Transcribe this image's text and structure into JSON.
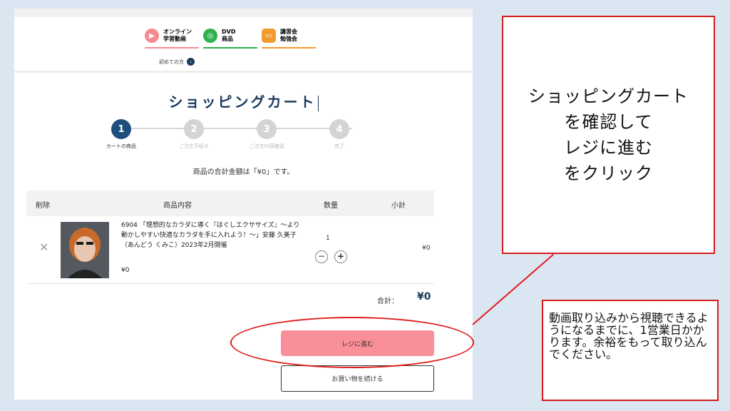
{
  "header": {
    "nav": [
      {
        "label_line1": "オンライン",
        "label_line2": "学習動画",
        "icon": "play-icon",
        "color": "#f58a93"
      },
      {
        "label_line1": "DVD",
        "label_line2": "商品",
        "icon": "disc-icon",
        "color": "#2fb14b"
      },
      {
        "label_line1": "講習会",
        "label_line2": "勉強会",
        "icon": "seminar-icon",
        "color": "#f39a2e"
      }
    ],
    "first_time_label": "初めての方"
  },
  "page_title": "ショッピングカート",
  "steps": [
    {
      "number": "1",
      "label": "カートの商品",
      "active": true
    },
    {
      "number": "2",
      "label": "ご注文手続き",
      "active": false
    },
    {
      "number": "3",
      "label": "ご注文内容確認",
      "active": false
    },
    {
      "number": "4",
      "label": "完了",
      "active": false
    }
  ],
  "total_message": "商品の合計金額は「¥0」です。",
  "cart": {
    "columns": {
      "remove": "削除",
      "item": "商品内容",
      "quantity": "数量",
      "subtotal": "小計"
    },
    "items": [
      {
        "description": "6904 「理想的なカラダに導く『ほぐしエクササイズ』〜より動かしやすい快適なカラダを手に入れよう！〜」安藤 久美子（あんどう くみこ）2023年2月開催",
        "price": "¥0",
        "quantity": "1",
        "subtotal": "¥0"
      }
    ],
    "total_label": "合計：",
    "total_value": "¥0"
  },
  "buttons": {
    "checkout": "レジに進む",
    "continue": "お買い物を続ける"
  },
  "callouts": {
    "main_line1": "ショッピングカート",
    "main_line2": "を確認して",
    "main_line3": "レジに進む",
    "main_line4": "をクリック",
    "note": "動画取り込みから視聴できるようになるまでに、1営業日かかります。余裕をもって取り込んでください。"
  },
  "colors": {
    "brand_navy": "#1d3b5c",
    "checkout_pink": "#f98f99",
    "annotation_red": "#d81b1b"
  }
}
